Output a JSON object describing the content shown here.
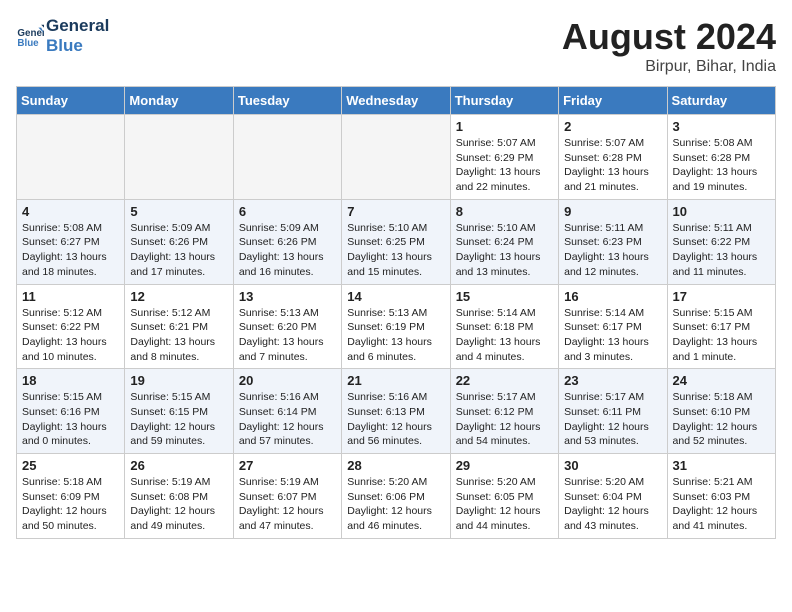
{
  "header": {
    "logo_line1": "General",
    "logo_line2": "Blue",
    "month_year": "August 2024",
    "location": "Birpur, Bihar, India"
  },
  "weekdays": [
    "Sunday",
    "Monday",
    "Tuesday",
    "Wednesday",
    "Thursday",
    "Friday",
    "Saturday"
  ],
  "weeks": [
    [
      {
        "day": "",
        "info": ""
      },
      {
        "day": "",
        "info": ""
      },
      {
        "day": "",
        "info": ""
      },
      {
        "day": "",
        "info": ""
      },
      {
        "day": "1",
        "info": "Sunrise: 5:07 AM\nSunset: 6:29 PM\nDaylight: 13 hours\nand 22 minutes."
      },
      {
        "day": "2",
        "info": "Sunrise: 5:07 AM\nSunset: 6:28 PM\nDaylight: 13 hours\nand 21 minutes."
      },
      {
        "day": "3",
        "info": "Sunrise: 5:08 AM\nSunset: 6:28 PM\nDaylight: 13 hours\nand 19 minutes."
      }
    ],
    [
      {
        "day": "4",
        "info": "Sunrise: 5:08 AM\nSunset: 6:27 PM\nDaylight: 13 hours\nand 18 minutes."
      },
      {
        "day": "5",
        "info": "Sunrise: 5:09 AM\nSunset: 6:26 PM\nDaylight: 13 hours\nand 17 minutes."
      },
      {
        "day": "6",
        "info": "Sunrise: 5:09 AM\nSunset: 6:26 PM\nDaylight: 13 hours\nand 16 minutes."
      },
      {
        "day": "7",
        "info": "Sunrise: 5:10 AM\nSunset: 6:25 PM\nDaylight: 13 hours\nand 15 minutes."
      },
      {
        "day": "8",
        "info": "Sunrise: 5:10 AM\nSunset: 6:24 PM\nDaylight: 13 hours\nand 13 minutes."
      },
      {
        "day": "9",
        "info": "Sunrise: 5:11 AM\nSunset: 6:23 PM\nDaylight: 13 hours\nand 12 minutes."
      },
      {
        "day": "10",
        "info": "Sunrise: 5:11 AM\nSunset: 6:22 PM\nDaylight: 13 hours\nand 11 minutes."
      }
    ],
    [
      {
        "day": "11",
        "info": "Sunrise: 5:12 AM\nSunset: 6:22 PM\nDaylight: 13 hours\nand 10 minutes."
      },
      {
        "day": "12",
        "info": "Sunrise: 5:12 AM\nSunset: 6:21 PM\nDaylight: 13 hours\nand 8 minutes."
      },
      {
        "day": "13",
        "info": "Sunrise: 5:13 AM\nSunset: 6:20 PM\nDaylight: 13 hours\nand 7 minutes."
      },
      {
        "day": "14",
        "info": "Sunrise: 5:13 AM\nSunset: 6:19 PM\nDaylight: 13 hours\nand 6 minutes."
      },
      {
        "day": "15",
        "info": "Sunrise: 5:14 AM\nSunset: 6:18 PM\nDaylight: 13 hours\nand 4 minutes."
      },
      {
        "day": "16",
        "info": "Sunrise: 5:14 AM\nSunset: 6:17 PM\nDaylight: 13 hours\nand 3 minutes."
      },
      {
        "day": "17",
        "info": "Sunrise: 5:15 AM\nSunset: 6:17 PM\nDaylight: 13 hours\nand 1 minute."
      }
    ],
    [
      {
        "day": "18",
        "info": "Sunrise: 5:15 AM\nSunset: 6:16 PM\nDaylight: 13 hours\nand 0 minutes."
      },
      {
        "day": "19",
        "info": "Sunrise: 5:15 AM\nSunset: 6:15 PM\nDaylight: 12 hours\nand 59 minutes."
      },
      {
        "day": "20",
        "info": "Sunrise: 5:16 AM\nSunset: 6:14 PM\nDaylight: 12 hours\nand 57 minutes."
      },
      {
        "day": "21",
        "info": "Sunrise: 5:16 AM\nSunset: 6:13 PM\nDaylight: 12 hours\nand 56 minutes."
      },
      {
        "day": "22",
        "info": "Sunrise: 5:17 AM\nSunset: 6:12 PM\nDaylight: 12 hours\nand 54 minutes."
      },
      {
        "day": "23",
        "info": "Sunrise: 5:17 AM\nSunset: 6:11 PM\nDaylight: 12 hours\nand 53 minutes."
      },
      {
        "day": "24",
        "info": "Sunrise: 5:18 AM\nSunset: 6:10 PM\nDaylight: 12 hours\nand 52 minutes."
      }
    ],
    [
      {
        "day": "25",
        "info": "Sunrise: 5:18 AM\nSunset: 6:09 PM\nDaylight: 12 hours\nand 50 minutes."
      },
      {
        "day": "26",
        "info": "Sunrise: 5:19 AM\nSunset: 6:08 PM\nDaylight: 12 hours\nand 49 minutes."
      },
      {
        "day": "27",
        "info": "Sunrise: 5:19 AM\nSunset: 6:07 PM\nDaylight: 12 hours\nand 47 minutes."
      },
      {
        "day": "28",
        "info": "Sunrise: 5:20 AM\nSunset: 6:06 PM\nDaylight: 12 hours\nand 46 minutes."
      },
      {
        "day": "29",
        "info": "Sunrise: 5:20 AM\nSunset: 6:05 PM\nDaylight: 12 hours\nand 44 minutes."
      },
      {
        "day": "30",
        "info": "Sunrise: 5:20 AM\nSunset: 6:04 PM\nDaylight: 12 hours\nand 43 minutes."
      },
      {
        "day": "31",
        "info": "Sunrise: 5:21 AM\nSunset: 6:03 PM\nDaylight: 12 hours\nand 41 minutes."
      }
    ]
  ]
}
